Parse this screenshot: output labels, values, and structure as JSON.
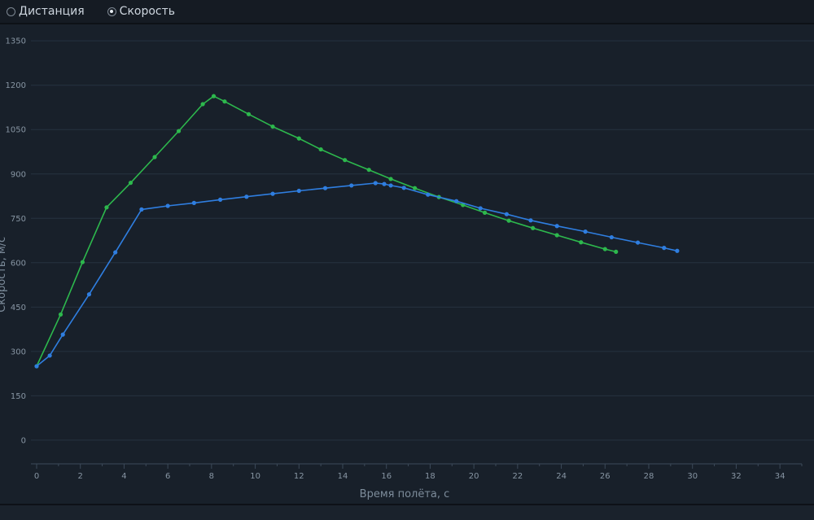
{
  "mode_selector": {
    "options": [
      {
        "label": "Дистанция",
        "checked": false
      },
      {
        "label": "Скорость",
        "checked": true
      }
    ]
  },
  "colors": {
    "background": "#18202a",
    "grid": "#263240",
    "axis": "#3c4a59",
    "series_green": "#2db84d",
    "series_blue": "#2f7ee0"
  },
  "chart_data": {
    "type": "line",
    "xlabel": "Время полёта, с",
    "ylabel": "Скорость, м/с",
    "xlim": [
      0,
      35
    ],
    "ylim": [
      -80,
      1400
    ],
    "x_ticks": [
      0,
      2,
      4,
      6,
      8,
      10,
      12,
      14,
      16,
      18,
      20,
      22,
      24,
      26,
      28,
      30,
      32,
      34
    ],
    "y_ticks": [
      0,
      150,
      300,
      450,
      600,
      750,
      900,
      1050,
      1200,
      1350
    ],
    "grid": true,
    "series": [
      {
        "color": "#2db84d",
        "points": [
          [
            0,
            250
          ],
          [
            1.1,
            425
          ],
          [
            2.1,
            602
          ],
          [
            3.2,
            787
          ],
          [
            4.3,
            870
          ],
          [
            5.4,
            957
          ],
          [
            6.5,
            1045
          ],
          [
            7.6,
            1136
          ],
          [
            8.1,
            1163
          ],
          [
            8.6,
            1145
          ],
          [
            9.7,
            1102
          ],
          [
            10.8,
            1060
          ],
          [
            12.0,
            1020
          ],
          [
            13.0,
            983
          ],
          [
            14.1,
            947
          ],
          [
            15.2,
            914
          ],
          [
            16.2,
            883
          ],
          [
            17.3,
            852
          ],
          [
            18.4,
            822
          ],
          [
            19.5,
            795
          ],
          [
            20.5,
            769
          ],
          [
            21.6,
            742
          ],
          [
            22.7,
            717
          ],
          [
            23.8,
            693
          ],
          [
            24.9,
            669
          ],
          [
            26.0,
            646
          ],
          [
            26.5,
            637
          ]
        ]
      },
      {
        "color": "#2f7ee0",
        "points": [
          [
            0,
            250
          ],
          [
            0.6,
            286
          ],
          [
            1.2,
            357
          ],
          [
            2.4,
            493
          ],
          [
            3.6,
            635
          ],
          [
            4.8,
            780
          ],
          [
            6.0,
            792
          ],
          [
            7.2,
            802
          ],
          [
            8.4,
            813
          ],
          [
            9.6,
            823
          ],
          [
            10.8,
            833
          ],
          [
            12.0,
            843
          ],
          [
            13.2,
            852
          ],
          [
            14.4,
            861
          ],
          [
            15.5,
            869
          ],
          [
            15.9,
            866
          ],
          [
            16.2,
            861
          ],
          [
            16.8,
            853
          ],
          [
            17.9,
            830
          ],
          [
            19.2,
            808
          ],
          [
            20.3,
            784
          ],
          [
            21.5,
            764
          ],
          [
            22.6,
            743
          ],
          [
            23.8,
            724
          ],
          [
            25.1,
            705
          ],
          [
            26.3,
            686
          ],
          [
            27.5,
            668
          ],
          [
            28.7,
            650
          ],
          [
            29.3,
            640
          ]
        ]
      }
    ]
  }
}
